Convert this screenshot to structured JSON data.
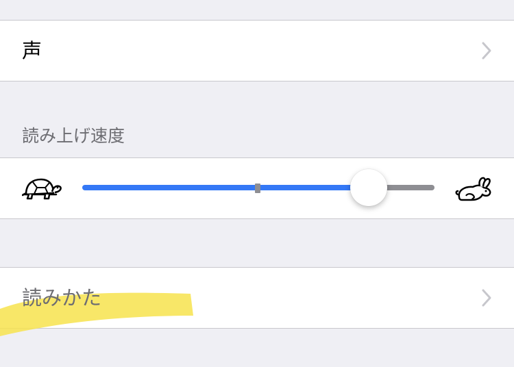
{
  "voice_row": {
    "label": "声"
  },
  "speed_section": {
    "header": "読み上げ速度",
    "value_fraction": 0.81
  },
  "pronunciation_row": {
    "label": "読みかた"
  },
  "icons": {
    "slow": "turtle-icon",
    "fast": "rabbit-icon",
    "disclosure": "chevron-right-icon"
  },
  "colors": {
    "accent": "#3478f6",
    "track": "#8e8e93",
    "highlight": "#f7e34d",
    "background": "#efeff4"
  }
}
